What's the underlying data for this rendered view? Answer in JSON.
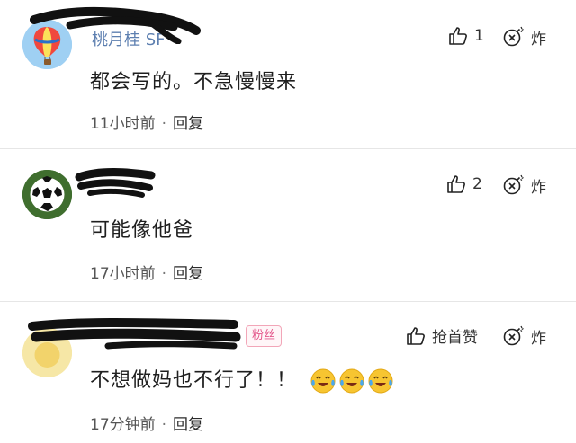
{
  "comments": [
    {
      "username": "桃月桂 SF",
      "content": "都会写的。不急慢慢来",
      "time": "11小时前",
      "reply_label": "回复",
      "like_count": "1",
      "bomb_label": "炸",
      "avatar": "hot-air-balloon-avatar"
    },
    {
      "username": "",
      "content": "可能像他爸",
      "time": "17小时前",
      "reply_label": "回复",
      "like_count": "2",
      "bomb_label": "炸",
      "avatar": "soccer-ball-avatar"
    },
    {
      "username": "",
      "badge": "粉丝",
      "content": "不想做妈也不行了！！",
      "emojis": [
        "crying-laughing-emoji",
        "crying-laughing-emoji",
        "crying-laughing-emoji"
      ],
      "time": "17分钟前",
      "reply_label": "回复",
      "like_label": "抢首赞",
      "bomb_label": "炸",
      "avatar": "yellow-avatar"
    }
  ],
  "separator": "·",
  "colors": {
    "username": "#5d7fb0",
    "badge": "#e4578b",
    "divider": "#e6e6e6",
    "text": "#1f1f1f",
    "meta": "#555555"
  }
}
